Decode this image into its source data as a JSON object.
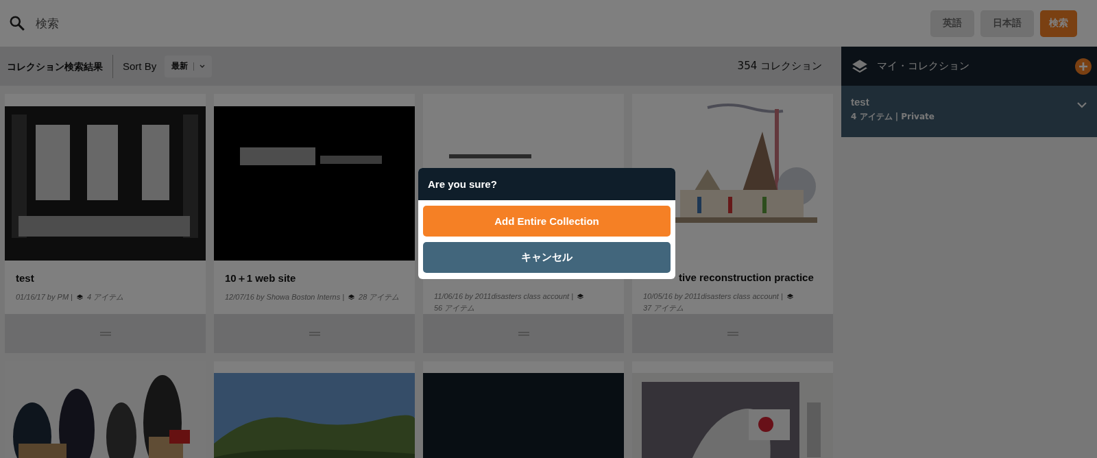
{
  "search": {
    "placeholder": "検索"
  },
  "top_buttons": [
    {
      "label": "英語",
      "kind": "language"
    },
    {
      "label": "日本語",
      "kind": "language"
    },
    {
      "label": "検索",
      "kind": "primary"
    }
  ],
  "results_bar": {
    "title": "コレクション検索結果",
    "sort_label": "Sort By",
    "sort_value": "最新",
    "count": "354 コレクション"
  },
  "collections": [
    {
      "title": "test",
      "meta": "01/16/17 by PM |",
      "items": "4 アイテム"
    },
    {
      "title": "10＋1 web site",
      "meta": "12/07/16 by Showa Boston Interns |",
      "items": "28 アイテム"
    },
    {
      "meta": "11/06/16 by 2011disasters class account |",
      "items": "56 アイテム"
    },
    {
      "title": "tive reconstruction practice",
      "partly_covered": true,
      "meta": "10/05/16 by 2011disasters class account |",
      "items": "37 アイテム"
    }
  ],
  "more_collections": [
    {
      "kind": "picture"
    },
    {
      "kind": "picture"
    },
    {
      "kind": "blank"
    },
    {
      "kind": "picture"
    }
  ],
  "my_collections": {
    "title": "マイ・コレクション",
    "items": [
      {
        "name": "test",
        "info": "4 アイテム | Private",
        "expanded": false
      }
    ]
  },
  "dialog": {
    "title": "Are you sure?",
    "buttons": [
      {
        "label": "Add Entire Collection",
        "kind": "confirm"
      },
      {
        "label": "キャンセル",
        "kind": "cancel"
      }
    ]
  }
}
